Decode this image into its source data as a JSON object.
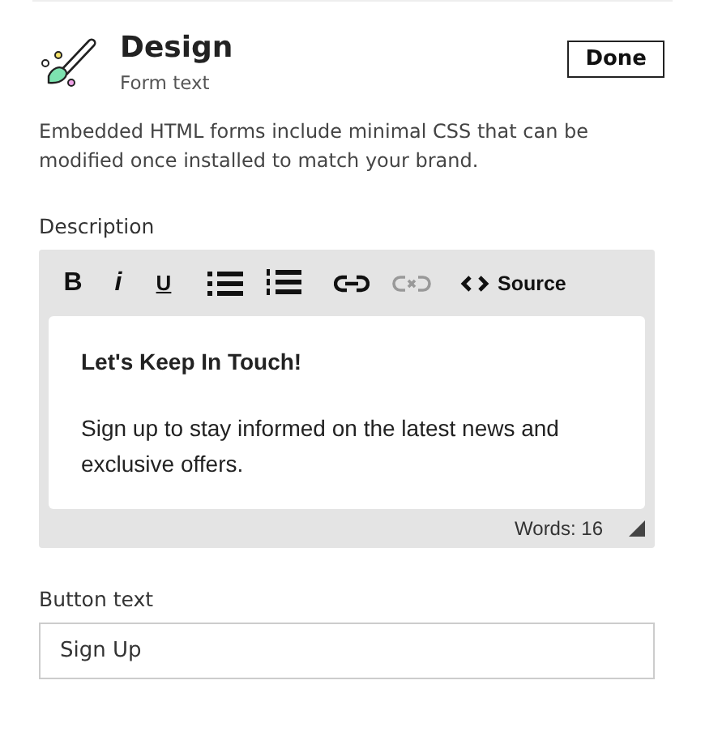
{
  "header": {
    "title": "Design",
    "subtitle": "Form text",
    "done_button": "Done"
  },
  "description": "Embedded HTML forms include minimal CSS that can be modified once installed to match your brand.",
  "editor": {
    "label": "Description",
    "toolbar": [
      {
        "kind": "bold",
        "label": "B",
        "disabled": false
      },
      {
        "kind": "italic",
        "label": "i",
        "disabled": false
      },
      {
        "kind": "underline",
        "label": "U",
        "disabled": false
      },
      {
        "kind": "bullets",
        "disabled": false
      },
      {
        "kind": "numbers",
        "disabled": false
      },
      {
        "kind": "link",
        "disabled": false
      },
      {
        "kind": "unlink",
        "disabled": true
      },
      {
        "kind": "source",
        "label": "Source",
        "disabled": false
      }
    ],
    "heading": "Let's Keep In Touch!",
    "body": "Sign up to stay informed on the latest news and exclusive offers.",
    "word_count": "Words: 16"
  },
  "button_text": {
    "label": "Button text",
    "value": "Sign Up"
  }
}
